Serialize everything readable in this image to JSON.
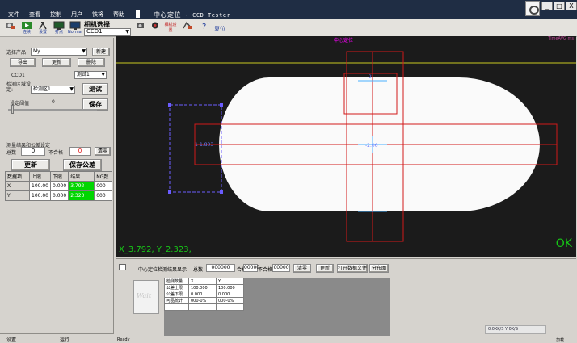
{
  "menu": [
    "文件",
    "查看",
    "控制",
    "用户",
    "铁将",
    "帮助"
  ],
  "title": {
    "main": "中心定位",
    "sub": " - CCD Tester"
  },
  "window_buttons": [
    "_",
    "□",
    "X"
  ],
  "toolbar": {
    "items": [
      {
        "label": ""
      },
      {
        "label": "连续"
      },
      {
        "label": "设置"
      },
      {
        "label": "打点"
      },
      {
        "label": "Normal"
      }
    ],
    "camera_select_label": "相机选择",
    "camera_select_value": "CCD1",
    "camera_settings_label": "相机设置",
    "reset_label": "复位"
  },
  "left": {
    "product_label": "选择产品",
    "product_value": "My",
    "new_button": "新建",
    "export_button": "导出",
    "update_button": "更新",
    "delete_button": "删除",
    "ccd_label": "CCD1",
    "test_select": "测试1",
    "region_label": "检测区域设定:",
    "region_value": "检测区1",
    "test_button": "测试",
    "save_button": "保存",
    "threshold_label": "设定阈值",
    "threshold_value": "0",
    "result_label": "测量结果和公差设定",
    "total_label": "总数",
    "total_value": "0",
    "ng_label": "不合格",
    "ng_value": "0",
    "clear_button": "清零",
    "update_big": "更新",
    "save_tol": "保存公差",
    "table": {
      "headers": [
        "数据项",
        "上限",
        "下限",
        "结果",
        "NG数"
      ],
      "rows": [
        [
          "X",
          "100.00",
          "0.000",
          "3.792",
          "000"
        ],
        [
          "Y",
          "100.00",
          "0.000",
          "2.323",
          "000"
        ]
      ]
    }
  },
  "left_status": [
    "设置",
    "运行"
  ],
  "view": {
    "title": "中心定位",
    "right_info": "TimeAVG ms",
    "coord": "X_3.792, Y_2.323,",
    "ok": "OK",
    "label1": "1",
    "label1_val": "1.803",
    "label2": "2",
    "center_label": "-2.06"
  },
  "bottom": {
    "check_label": "中心定位检测结果显示",
    "total_label": "总数",
    "total_value": "000000",
    "pass_label": "合格",
    "pass_value": "00000",
    "ng_label": "不合格",
    "ng_value": "00000",
    "clear_button": "清零",
    "update_button": "更新",
    "open_button": "打开数据文件",
    "dist_button": "分布图",
    "wait": "Wait",
    "table": [
      [
        "检测数量",
        "X",
        "Y"
      ],
      [
        "公差上限",
        "100.000",
        "100.000"
      ],
      [
        "公差下限",
        "0.000",
        "0.000"
      ],
      [
        "可品统计",
        "000-0%",
        "000-0%"
      ],
      [
        "",
        "",
        ""
      ]
    ],
    "speed": "0.0KK/S  Y    0K/S"
  },
  "status": {
    "ready": "Ready",
    "right": "加载"
  }
}
